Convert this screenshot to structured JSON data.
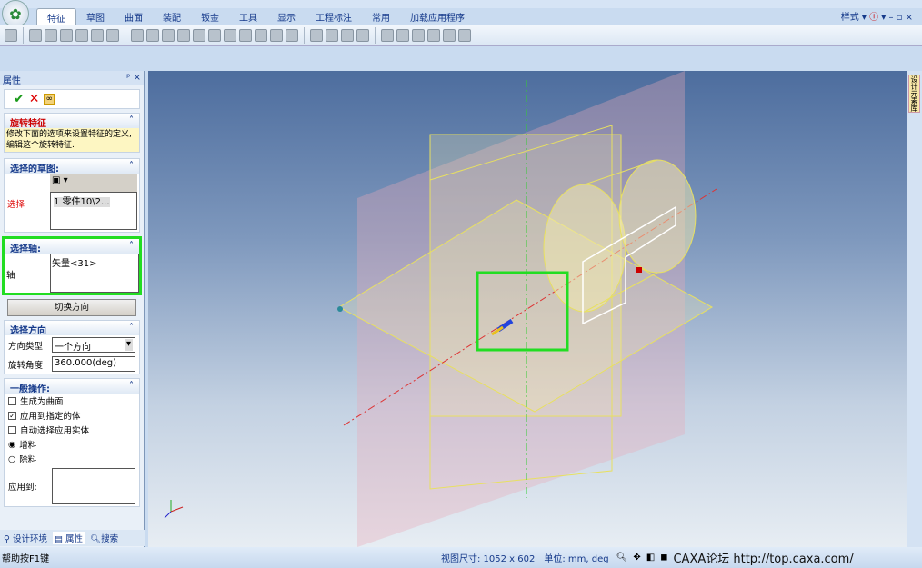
{
  "ribbon": {
    "tabs": [
      "特征",
      "草图",
      "曲面",
      "装配",
      "钣金",
      "工具",
      "显示",
      "工程标注",
      "常用",
      "加载应用程序"
    ],
    "active": 0,
    "style_menu": "样式"
  },
  "panel": {
    "title": "属性",
    "pin": "ᵖ",
    "close": "×",
    "ok_icon": "✔",
    "cancel_icon": "✕",
    "feature_section": {
      "title": "旋转特征",
      "description": "修改下面的选项来设置特征的定义,编辑这个旋转特征."
    },
    "sketch_section": {
      "title": "选择的草图:",
      "label": "选择",
      "item": "1  零件10\\2..."
    },
    "axis_section": {
      "title": "选择轴:",
      "label": "轴",
      "value": "矢量<31>"
    },
    "switch_direction": "切换方向",
    "direction_section": {
      "title": "选择方向",
      "type_label": "方向类型",
      "type_value": "一个方向",
      "angle_label": "旋转角度",
      "angle_value": "360.000(deg)"
    },
    "general_section": {
      "title": "一般操作:",
      "options": [
        {
          "label": "生成为曲面",
          "checked": false
        },
        {
          "label": "应用到指定的体",
          "checked": true
        },
        {
          "label": "自动选择应用实体",
          "checked": false
        }
      ],
      "radios": [
        {
          "label": "增料",
          "selected": true
        },
        {
          "label": "除料",
          "selected": false
        }
      ],
      "apply_to_label": "应用到:"
    },
    "bottom_tabs": [
      "设计环境",
      "属性",
      "搜索"
    ]
  },
  "right_sidebar": {
    "label": "设计元素库"
  },
  "status": {
    "help": "帮助按F1键",
    "view_size": "视图尺寸: 1052 x  602",
    "units": "单位: mm, deg",
    "watermark": "CAXA论坛 http://top.caxa.com/"
  },
  "colors": {
    "highlight": "#22dd22",
    "geometry": "#e8e060"
  }
}
